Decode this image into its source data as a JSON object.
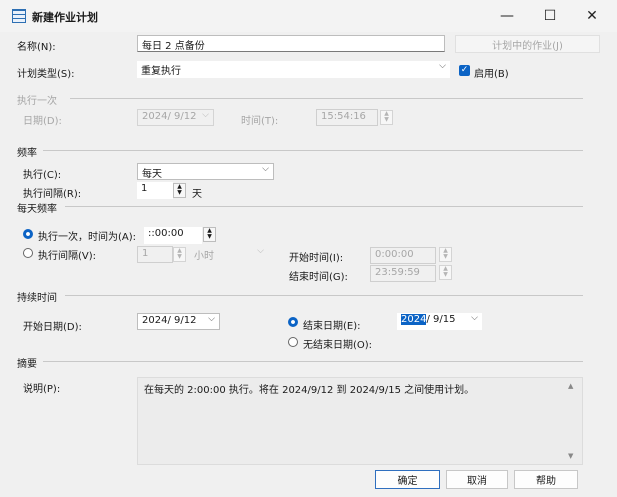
{
  "window": {
    "title": "新建作业计划",
    "minimize": "—",
    "maximize": "☐",
    "close": "✕"
  },
  "name_label": "名称(N):",
  "name_value": "每日 2 点备份",
  "jobs_button": "计划中的作业(J)",
  "schedule_type_label": "计划类型(S):",
  "schedule_type_value": "重复执行",
  "enabled_label": "启用(B)",
  "once": {
    "group": "执行一次",
    "date_label": "日期(D):",
    "date_value": "2024/ 9/12",
    "time_label": "时间(T):",
    "time_value": "15:54:16"
  },
  "frequency": {
    "group": "频率",
    "run_label": "执行(C):",
    "run_value": "每天",
    "interval_label": "执行间隔(R):",
    "interval_value": "1",
    "interval_unit": "天"
  },
  "daily": {
    "group": "每天频率",
    "once_label": "执行一次，时间为(A):",
    "once_time": "::00:00",
    "every_label": "执行间隔(V):",
    "every_value": "1",
    "every_unit": "小时",
    "start_label": "开始时间(I):",
    "start_value": "0:00:00",
    "end_label": "结束时间(G):",
    "end_value": "23:59:59"
  },
  "duration": {
    "group": "持续时间",
    "start_label": "开始日期(D):",
    "start_value": "2024/ 9/12",
    "end_label": "结束日期(E):",
    "end_year": "2024",
    "end_rest": "/ 9/15",
    "noend_label": "无结束日期(O):"
  },
  "summary": {
    "group": "摘要",
    "desc_label": "说明(P):",
    "desc_text": "在每天的 2:00:00 执行。将在 2024/9/12 到 2024/9/15 之间使用计划。"
  },
  "buttons": {
    "ok": "确定",
    "cancel": "取消",
    "help": "帮助"
  }
}
